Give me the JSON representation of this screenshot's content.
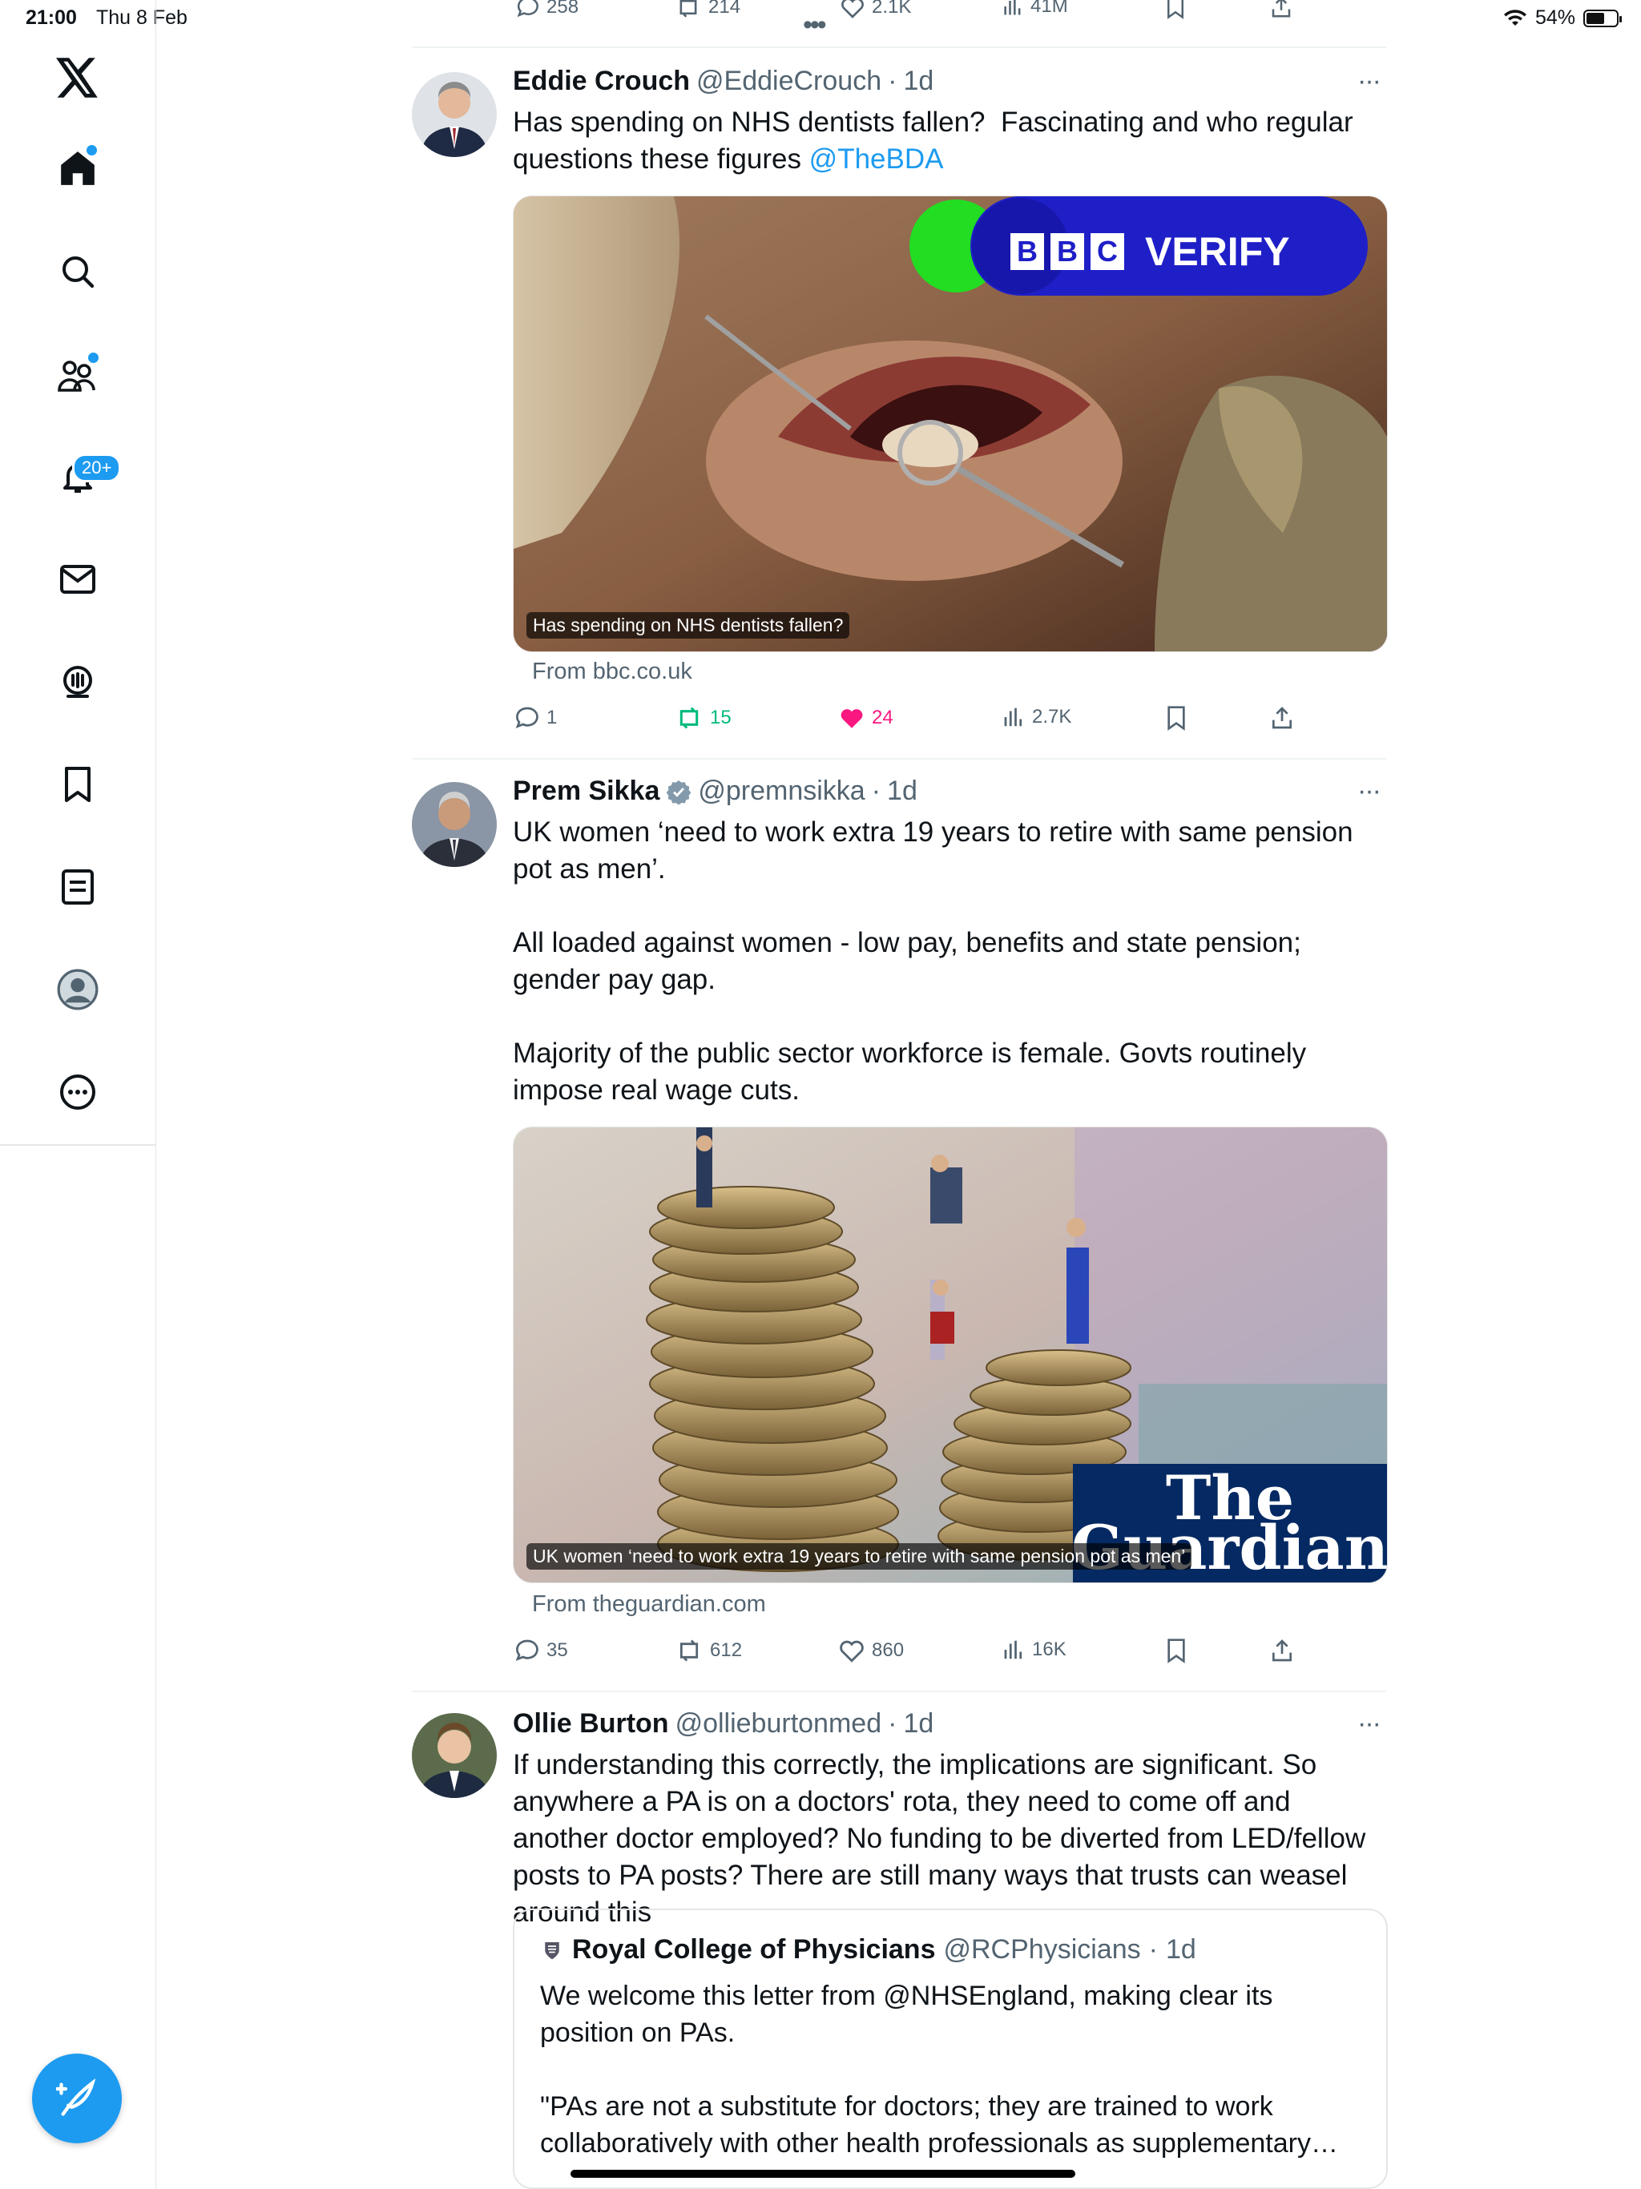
{
  "status": {
    "time": "21:00",
    "date": "Thu 8 Feb",
    "battery": "54%",
    "battery_level": 0.54
  },
  "sidebar": {
    "items": [
      "logo",
      "home",
      "search",
      "communities",
      "notifications",
      "messages",
      "grok",
      "bookmarks",
      "lists",
      "profile",
      "more"
    ],
    "notifications_badge": "20+",
    "accent_color": "#1d9bf0"
  },
  "top_actions": {
    "replies": "258",
    "reposts": "214",
    "likes": "2.1K",
    "views": "41M"
  },
  "tweets": [
    {
      "name": "Eddie Crouch",
      "handle": "@EddieCrouch",
      "time": "1d",
      "text": "Has spending on NHS dentists fallen?  Fascinating and who regular questions these figures ",
      "mention": "@TheBDA",
      "card": {
        "logo": "VERIFY",
        "caption": "Has spending on NHS dentists fallen?",
        "source": "From bbc.co.uk",
        "bbc_letters": [
          "B",
          "B",
          "C"
        ]
      },
      "replies": "1",
      "reposts": "15",
      "likes": "24",
      "views": "2.7K",
      "liked": true,
      "reposted": true
    },
    {
      "name": "Prem Sikka",
      "handle": "@premnsikka",
      "time": "1d",
      "verified": true,
      "text": "UK women ‘need to work extra 19 years to retire with same pension pot as men’.\n\nAll loaded against women - low pay, benefits and state pension; gender pay gap.\n\nMajority of the public sector workforce is female. Govts routinely impose real wage cuts.",
      "card": {
        "logo_line1": "The",
        "logo_line2": "Guardian",
        "caption": "UK women ‘need to work extra 19 years to retire with same pension pot as men’",
        "source": "From theguardian.com"
      },
      "replies": "35",
      "reposts": "612",
      "likes": "860",
      "views": "16K"
    },
    {
      "name": "Ollie Burton",
      "handle": "@ollieburtonmed",
      "time": "1d",
      "text": "If understanding this correctly, the implications are significant. So anywhere a PA is on a doctors' rota, they need to come off and another doctor employed? No funding to be diverted from LED/fellow posts to PA posts? There are still many ways that trusts can weasel around this",
      "quote": {
        "name": "Royal College of Physicians",
        "handle": "@RCPhysicians",
        "time": "1d",
        "text": "We welcome this letter from @NHSEngland, making clear its position on PAs.\n\n\"PAs are not a substitute for doctors; they are trained to work collaboratively with other health professionals as supplementary…"
      }
    }
  ]
}
